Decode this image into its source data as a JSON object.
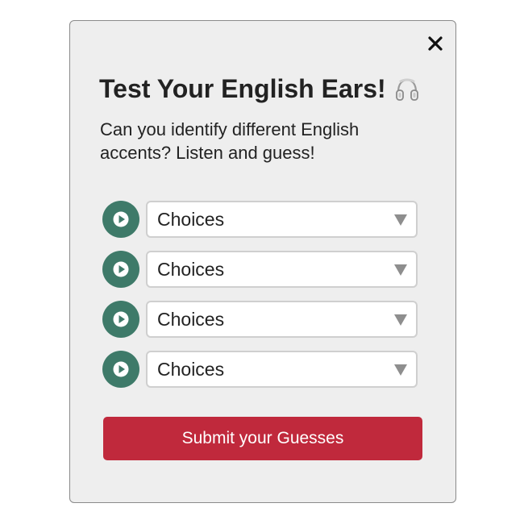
{
  "modal": {
    "title": "Test Your English Ears!",
    "title_icon": "headphones-icon",
    "subtitle": "Can you identify different English accents? Listen and guess!",
    "close_icon": "close-icon"
  },
  "accent_rows": [
    {
      "play_icon": "play-icon",
      "select_value": "Choices"
    },
    {
      "play_icon": "play-icon",
      "select_value": "Choices"
    },
    {
      "play_icon": "play-icon",
      "select_value": "Choices"
    },
    {
      "play_icon": "play-icon",
      "select_value": "Choices"
    }
  ],
  "submit": {
    "label": "Submit your Guesses"
  },
  "colors": {
    "play_button": "#3e7a69",
    "submit_button": "#c0293c",
    "modal_background": "#eeeeee"
  }
}
